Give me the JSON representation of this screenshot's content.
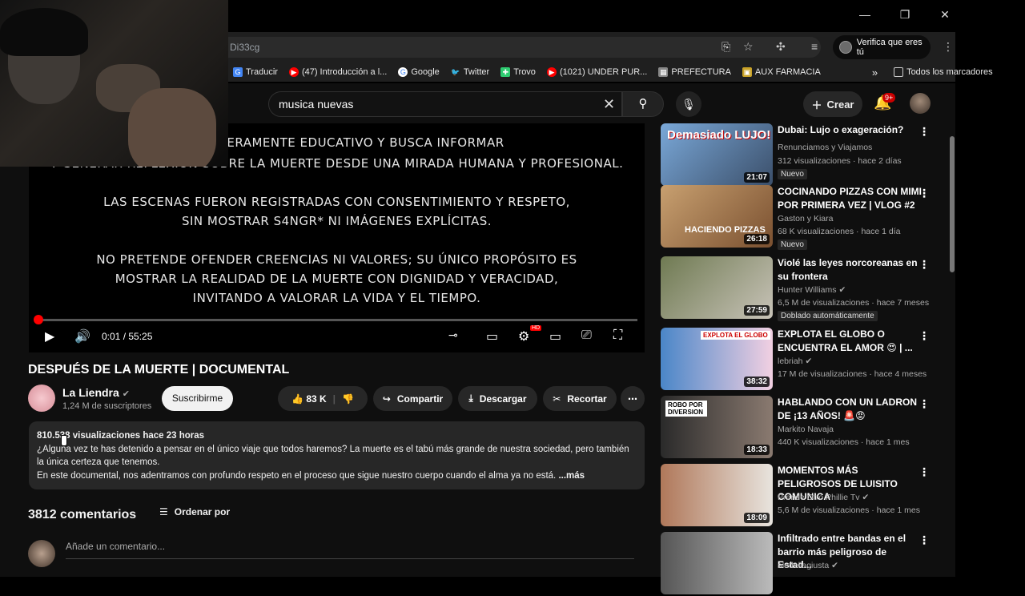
{
  "browser": {
    "url": "Di33cg",
    "verify_label": "Verifica que eres tú",
    "bookmarks": [
      "Traducir",
      "(47) Introducción a l...",
      "Google",
      "Twitter",
      "Trovo",
      "(1021) UNDER PUR...",
      "PREFECTURA",
      "AUX FARMACIA"
    ],
    "all_bookmarks": "Todos los marcadores"
  },
  "youtube": {
    "search_query": "musica nuevas",
    "create_label": "Crear",
    "notif_count": "9+"
  },
  "player": {
    "lines": [
      "TAL ES MERAMENTE EDUCATIVO Y BUSCA INFORMAR",
      "Y GENERAR REFLEXIÓN SOBRE LA MUERTE DESDE UNA MIRADA HUMANA Y PROFESIONAL.",
      "LAS ESCENAS FUERON REGISTRADAS CON CONSENTIMIENTO Y RESPETO,",
      "SIN MOSTRAR S4NGR* NI IMÁGENES EXPLÍCITAS.",
      "NO PRETENDE OFENDER CREENCIAS NI VALORES; SU ÚNICO PROPÓSITO ES",
      "MOSTRAR LA REALIDAD DE LA MUERTE CON DIGNIDAD Y VERACIDAD,",
      "INVITANDO A VALORAR LA VIDA Y EL TIEMPO."
    ],
    "time": "0:01 / 55:25",
    "progress": 0.0003,
    "hd_badge": "HD"
  },
  "video": {
    "title": "DESPUÉS DE LA MUERTE | DOCUMENTAL",
    "channel": "La Liendra",
    "subscribers": "1,24 M de suscriptores",
    "subscribe": "Suscribirme",
    "likes": "83 K",
    "share": "Compartir",
    "download": "Descargar",
    "clip": "Recortar",
    "stats": "810.538 visualizaciones  hace 23 horas",
    "desc1": "¿Alguna vez te has detenido a pensar en el único viaje que todos haremos? La muerte es el tabú más grande de nuestra sociedad, pero también la única certeza que tenemos.",
    "desc2": "En este documental, nos adentramos con profundo respeto en el proceso que sigue nuestro cuerpo cuando el alma ya no está.",
    "more": "...más"
  },
  "comments": {
    "count": "3812 comentarios",
    "sort": "Ordenar por",
    "placeholder": "Añade un comentario..."
  },
  "recommendations": [
    {
      "title": "Dubai: Lujo o exageración?",
      "channel": "Renunciamos y Viajamos",
      "meta": "312 visualizaciones · hace 2 días",
      "badge": "Nuevo",
      "duration": "21:07",
      "thumb_text": "Demasiado LUJO!",
      "verified": false
    },
    {
      "title": "COCINANDO PIZZAS CON MIMI POR PRIMERA VEZ | VLOG #2",
      "channel": "Gaston y Kiara",
      "meta": "68 K visualizaciones · hace 1 día",
      "badge": "Nuevo",
      "duration": "26:18",
      "thumb_text": "HACIENDO PIZZAS",
      "verified": false
    },
    {
      "title": "Violé las leyes norcoreanas en su frontera",
      "channel": "Hunter Williams",
      "meta": "6,5 M de visualizaciones · hace 7 meses",
      "badge": "Doblado automáticamente",
      "duration": "27:59",
      "thumb_text": "",
      "verified": true
    },
    {
      "title": "EXPLOTA EL GLOBO O ENCUENTRA EL AMOR 😍 | ...",
      "channel": "lebriah",
      "meta": "17 M de visualizaciones · hace 4 meses",
      "badge": "",
      "duration": "38:32",
      "thumb_text": "EXPLOTA EL GLOBO",
      "verified": true
    },
    {
      "title": "HABLANDO CON UN LADRON DE ¡13 AÑOS! 🚨😡",
      "channel": "Markito Navaja",
      "meta": "440 K visualizaciones · hace 1 mes",
      "badge": "",
      "duration": "18:33",
      "thumb_text": "ROBO POR DIVERSION",
      "verified": false
    },
    {
      "title": "MOMENTOS MÁS PELIGROSOS DE LUISITO COMUNICA",
      "channel": "Prende Otro Phillie Tv",
      "meta": "5,6 M de visualizaciones · hace 1 mes",
      "badge": "",
      "duration": "18:09",
      "thumb_text": "",
      "verified": true
    },
    {
      "title": "Infiltrado entre bandas en el barrio más peligroso de Estad...",
      "channel": "aledellagiusta",
      "meta": "",
      "badge": "",
      "duration": "",
      "thumb_text": "",
      "verified": true
    }
  ],
  "colors": {
    "bg": "#0f0f0f",
    "accent": "#ff0000",
    "pill": "#272727"
  }
}
